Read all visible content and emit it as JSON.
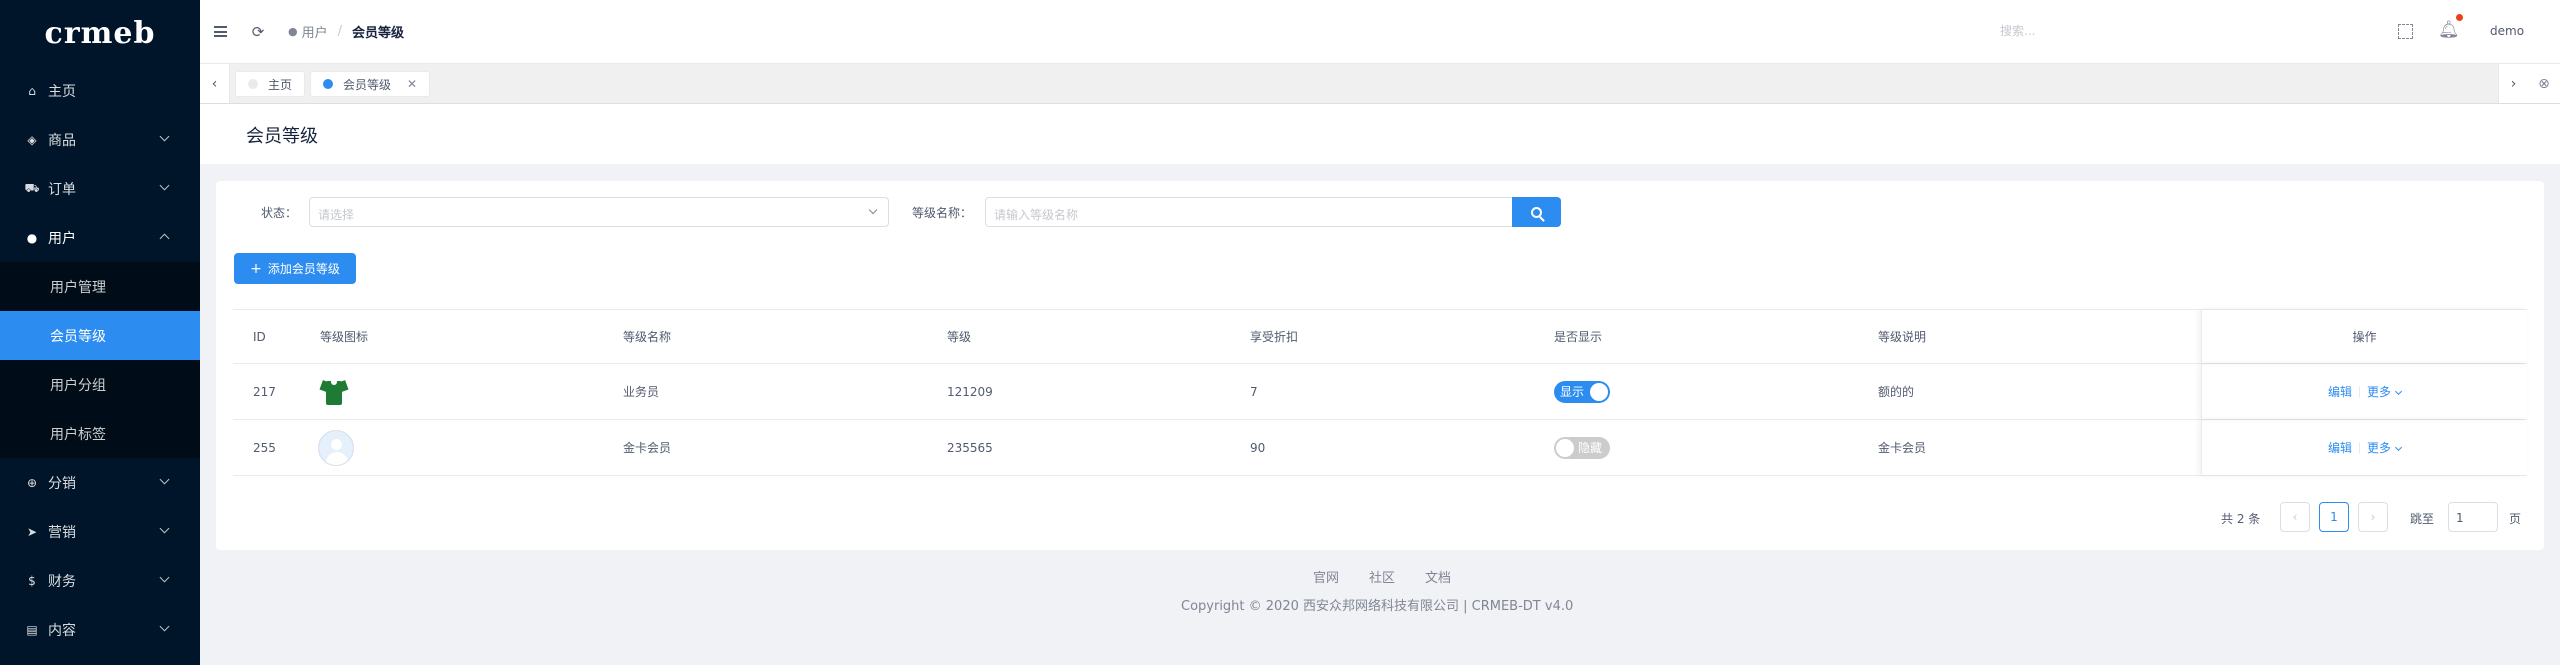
{
  "brand": {
    "logo_text": "crmeb"
  },
  "sidebar": {
    "items": [
      {
        "label": "主页",
        "icon": "home-icon",
        "glyph": "⌂"
      },
      {
        "label": "商品",
        "icon": "shop-icon",
        "glyph": "◈"
      },
      {
        "label": "订单",
        "icon": "cart-icon",
        "glyph": "⛟"
      },
      {
        "label": "用户",
        "icon": "user-icon",
        "glyph": "●"
      },
      {
        "label": "分销",
        "icon": "share-icon",
        "glyph": "⊕"
      },
      {
        "label": "营销",
        "icon": "send-icon",
        "glyph": "➤"
      },
      {
        "label": "财务",
        "icon": "dollar-icon",
        "glyph": "$"
      },
      {
        "label": "内容",
        "icon": "book-icon",
        "glyph": "▤"
      }
    ],
    "user_submenu": [
      "用户管理",
      "会员等级",
      "用户分组",
      "用户标签"
    ]
  },
  "header": {
    "breadcrumb_parent": "用户",
    "breadcrumb_sep": "/",
    "breadcrumb_current": "会员等级",
    "search_placeholder": "搜索...",
    "username": "demo"
  },
  "tabs": [
    {
      "label": "主页",
      "active": false
    },
    {
      "label": "会员等级",
      "active": true
    }
  ],
  "page": {
    "title": "会员等级"
  },
  "filters": {
    "status_label": "状态：",
    "status_placeholder": "请选择",
    "name_label": "等级名称：",
    "name_placeholder": "请输入等级名称"
  },
  "add_button_label": "添加会员等级",
  "table": {
    "headers": [
      "ID",
      "等级图标",
      "等级名称",
      "等级",
      "享受折扣",
      "是否显示",
      "等级说明",
      "操作"
    ],
    "rows": [
      {
        "id": "217",
        "icon": "green-shirt",
        "name": "业务员",
        "grade": "121209",
        "discount": "7",
        "show": true,
        "show_label": "显示",
        "desc": "额的的",
        "edit": "编辑",
        "more": "更多"
      },
      {
        "id": "255",
        "icon": "default-avatar",
        "name": "金卡会员",
        "grade": "235565",
        "discount": "90",
        "show": false,
        "show_label": "隐藏",
        "desc": "金卡会员",
        "edit": "编辑",
        "more": "更多"
      }
    ]
  },
  "pagination": {
    "total_text": "共 2 条",
    "prev": "‹",
    "next": "›",
    "current_page": "1",
    "jump_label": "跳至",
    "jump_value": "1",
    "page_label": "页"
  },
  "footer": {
    "links": [
      "官网",
      "社区",
      "文档"
    ],
    "copyright": "Copyright © 2020 西安众邦网络科技有限公司 | CRMEB-DT v4.0"
  },
  "colors": {
    "primary": "#2d8cf0",
    "sidebar_bg": "#001529",
    "badge": "#ed4014"
  }
}
